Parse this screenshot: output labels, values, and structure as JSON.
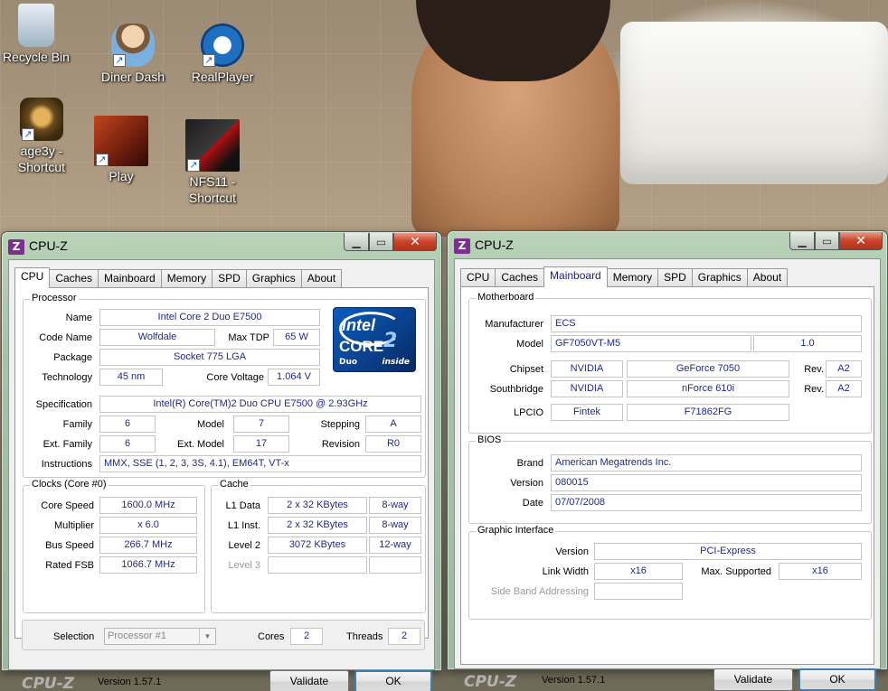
{
  "desktop": {
    "icons": [
      {
        "label": "Recycle Bin",
        "icon": "recycle-bin-icon"
      },
      {
        "label": "Diner Dash",
        "icon": "diner-dash-icon"
      },
      {
        "label": "RealPlayer",
        "icon": "realplayer-icon"
      },
      {
        "label": "age3y - Shortcut",
        "icon": "age3y-icon"
      },
      {
        "label": "Play",
        "icon": "play-icon"
      },
      {
        "label": "NFS11 - Shortcut",
        "icon": "nfs11-icon"
      }
    ]
  },
  "windows": [
    {
      "title": "CPU-Z",
      "logo_letter": "Z",
      "tabs": [
        "CPU",
        "Caches",
        "Mainboard",
        "Memory",
        "SPD",
        "Graphics",
        "About"
      ],
      "active_tab": "CPU",
      "processor": {
        "legend": "Processor",
        "name_label": "Name",
        "name": "Intel Core 2 Duo E7500",
        "codename_label": "Code Name",
        "codename": "Wolfdale",
        "maxtdp_label": "Max TDP",
        "maxtdp": "65 W",
        "package_label": "Package",
        "package": "Socket 775 LGA",
        "technology_label": "Technology",
        "technology": "45 nm",
        "corevoltage_label": "Core Voltage",
        "corevoltage": "1.064 V",
        "spec_label": "Specification",
        "spec": "Intel(R) Core(TM)2 Duo CPU     E7500  @ 2.93GHz",
        "family_label": "Family",
        "family": "6",
        "model_label": "Model",
        "model": "7",
        "stepping_label": "Stepping",
        "stepping": "A",
        "extfamily_label": "Ext. Family",
        "extfamily": "6",
        "extmodel_label": "Ext. Model",
        "extmodel": "17",
        "revision_label": "Revision",
        "revision": "R0",
        "instructions_label": "Instructions",
        "instructions": "MMX, SSE (1, 2, 3, 3S, 4.1), EM64T, VT-x",
        "logo": {
          "brand": "intel",
          "line": "CORE",
          "gen": "2",
          "sub": "Duo",
          "tag": "inside"
        }
      },
      "clocks": {
        "legend": "Clocks (Core #0)",
        "corespeed_label": "Core Speed",
        "corespeed": "1600.0 MHz",
        "multiplier_label": "Multiplier",
        "multiplier": "x 6.0",
        "busspeed_label": "Bus Speed",
        "busspeed": "266.7 MHz",
        "ratedfsb_label": "Rated FSB",
        "ratedfsb": "1066.7 MHz"
      },
      "cache": {
        "legend": "Cache",
        "l1data_label": "L1 Data",
        "l1data": "2 x 32 KBytes",
        "l1data_way": "8-way",
        "l1inst_label": "L1 Inst.",
        "l1inst": "2 x 32 KBytes",
        "l1inst_way": "8-way",
        "level2_label": "Level 2",
        "level2": "3072 KBytes",
        "level2_way": "12-way",
        "level3_label": "Level 3"
      },
      "selection": {
        "label": "Selection",
        "value": "Processor #1",
        "cores_label": "Cores",
        "cores": "2",
        "threads_label": "Threads",
        "threads": "2"
      },
      "footer": {
        "brand": "CPU-Z",
        "version": "Version 1.57.1",
        "validate": "Validate",
        "ok": "OK"
      }
    },
    {
      "title": "CPU-Z",
      "logo_letter": "Z",
      "tabs": [
        "CPU",
        "Caches",
        "Mainboard",
        "Memory",
        "SPD",
        "Graphics",
        "About"
      ],
      "active_tab": "Mainboard",
      "motherboard": {
        "legend": "Motherboard",
        "manufacturer_label": "Manufacturer",
        "manufacturer": "ECS",
        "model_label": "Model",
        "model": "GF7050VT-M5",
        "model_rev": "1.0",
        "chipset_label": "Chipset",
        "chipset_vendor": "NVIDIA",
        "chipset_name": "GeForce 7050",
        "chipset_rev_label": "Rev.",
        "chipset_rev": "A2",
        "southbridge_label": "Southbridge",
        "southbridge_vendor": "NVIDIA",
        "southbridge_name": "nForce 610i",
        "southbridge_rev_label": "Rev.",
        "southbridge_rev": "A2",
        "lpcio_label": "LPCIO",
        "lpcio_vendor": "Fintek",
        "lpcio_name": "F71862FG"
      },
      "bios": {
        "legend": "BIOS",
        "brand_label": "Brand",
        "brand": "American Megatrends Inc.",
        "version_label": "Version",
        "version": "080015",
        "date_label": "Date",
        "date": "07/07/2008"
      },
      "graphic": {
        "legend": "Graphic Interface",
        "version_label": "Version",
        "version": "PCI-Express",
        "linkwidth_label": "Link Width",
        "linkwidth": "x16",
        "maxsupported_label": "Max. Supported",
        "maxsupported": "x16",
        "sideband_label": "Side Band Addressing"
      },
      "footer": {
        "brand": "CPU-Z",
        "version": "Version 1.57.1",
        "validate": "Validate",
        "ok": "OK"
      }
    }
  ]
}
